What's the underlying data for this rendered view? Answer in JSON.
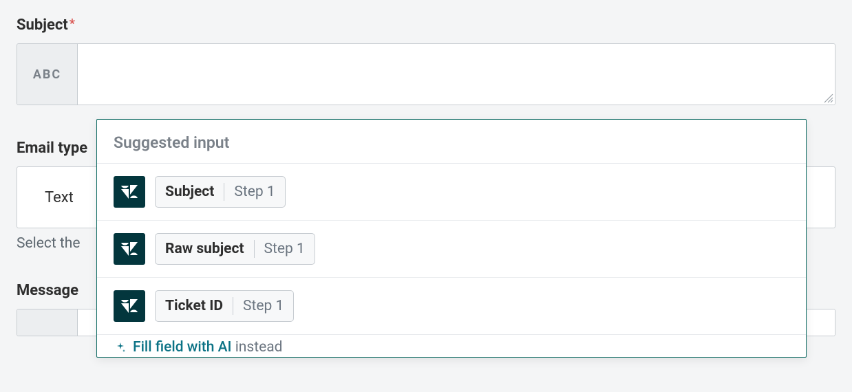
{
  "fields": {
    "subject": {
      "label": "Subject",
      "required_mark": "*",
      "prefix_badge": "ABC",
      "value": ""
    },
    "email_type": {
      "label": "Email type",
      "value": "Text",
      "helper": "Select the"
    },
    "message": {
      "label": "Message"
    }
  },
  "dropdown": {
    "heading": "Suggested input",
    "items": [
      {
        "label": "Subject",
        "step": "Step 1",
        "icon": "zendesk"
      },
      {
        "label": "Raw subject",
        "step": "Step 1",
        "icon": "zendesk"
      },
      {
        "label": "Ticket ID",
        "step": "Step 1",
        "icon": "zendesk"
      }
    ],
    "footer": {
      "link_text": "Fill field with AI",
      "suffix_text": "instead"
    }
  }
}
